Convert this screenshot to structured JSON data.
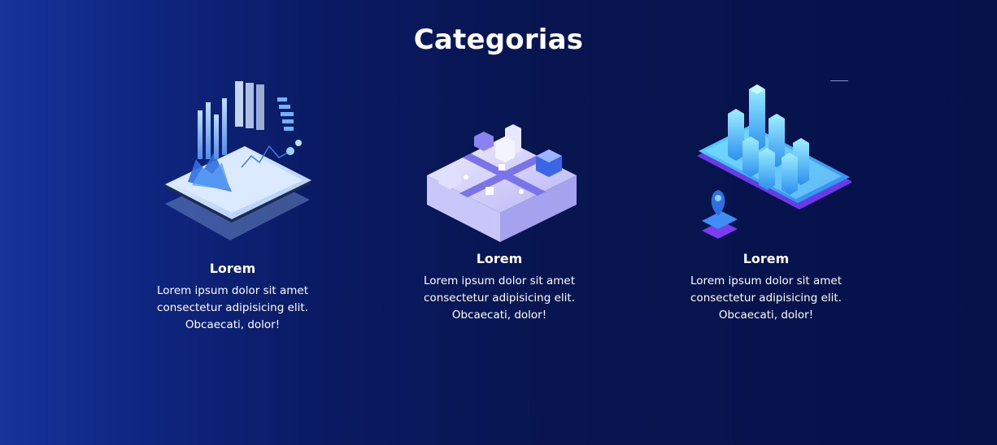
{
  "section": {
    "title": "Categorias"
  },
  "cards": [
    {
      "title": "Lorem",
      "text": "Lorem ipsum dolor sit amet consectetur adipisicing elit. Obcaecati, dolor!",
      "illustration": "analytics-tablet-icon"
    },
    {
      "title": "Lorem",
      "text": "Lorem ipsum dolor sit amet consectetur adipisicing elit. Obcaecati, dolor!",
      "illustration": "isometric-city-block-icon"
    },
    {
      "title": "Lorem",
      "text": "Lorem ipsum dolor sit amet consectetur adipisicing elit. Obcaecati, dolor!",
      "illustration": "smartphone-city-map-pin-icon"
    }
  ],
  "colors": {
    "background_left": "#16349a",
    "background_right": "#06114a",
    "text": "#ffffff",
    "accent_cyan": "#3db6e6",
    "accent_purple": "#7c3aed"
  }
}
